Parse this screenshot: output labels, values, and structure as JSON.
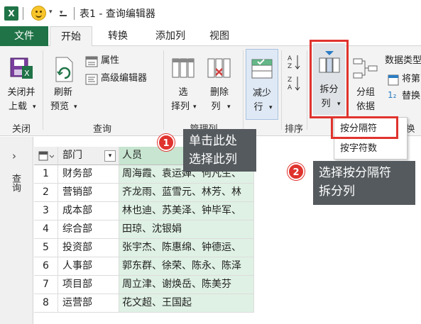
{
  "titlebar": {
    "excel_glyph": "X",
    "title": "表1 - 查询编辑器"
  },
  "tabs": [
    {
      "label": "文件"
    },
    {
      "label": "开始"
    },
    {
      "label": "转换"
    },
    {
      "label": "添加列"
    },
    {
      "label": "视图"
    }
  ],
  "ribbon": {
    "close_load": {
      "line1": "关闭并",
      "line2": "上载",
      "caret": "▾"
    },
    "refresh": {
      "line1": "刷新",
      "line2": "预览",
      "caret": "▾"
    },
    "properties": "属性",
    "advanced_editor": "高级编辑器",
    "choose_columns": {
      "line1": "选",
      "line2": "择列",
      "caret": "▾"
    },
    "remove_columns": {
      "line1": "删除",
      "line2": "列",
      "caret": "▾"
    },
    "reduce_rows": {
      "line1": "减少",
      "line2": "行",
      "caret": "▾"
    },
    "split_column": {
      "line1": "拆分",
      "line2": "列",
      "caret": "▾"
    },
    "group_by": {
      "line1": "分组",
      "line2": "依据"
    },
    "data_type": "数据类型",
    "use_first_row": "将第",
    "replace": "替换",
    "groups": {
      "close": "关闭",
      "query": "查询",
      "manage_columns": "管理列",
      "sort": "排序",
      "transform": "换"
    }
  },
  "dropdown": {
    "items": [
      "按分隔符",
      "按字符数"
    ]
  },
  "sidebar": {
    "label": "查询",
    "chevron": "›"
  },
  "table": {
    "columns": [
      "部门",
      "人员"
    ],
    "rows": [
      {
        "num": "1",
        "dept": "财务部",
        "people": "周海霞、袁运婵、何凡生、"
      },
      {
        "num": "2",
        "dept": "营销部",
        "people": "齐龙雨、蓝雪元、林芳、林"
      },
      {
        "num": "3",
        "dept": "成本部",
        "people": "林也迪、苏美泽、钟毕军、"
      },
      {
        "num": "4",
        "dept": "综合部",
        "people": "田琼、沈银娟"
      },
      {
        "num": "5",
        "dept": "投资部",
        "people": "张宇杰、陈惠绵、钟德运、"
      },
      {
        "num": "6",
        "dept": "人事部",
        "people": "郭东群、徐荣、陈永、陈泽"
      },
      {
        "num": "7",
        "dept": "项目部",
        "people": "周立津、谢焕岳、陈美芬"
      },
      {
        "num": "8",
        "dept": "运营部",
        "people": "花文超、王国起"
      }
    ]
  },
  "callouts": [
    {
      "badge": "1",
      "line1": "单击此处",
      "line2": "选择此列"
    },
    {
      "badge": "2",
      "line1": "选择按分隔符",
      "line2": "拆分列"
    }
  ],
  "colors": {
    "excel_green": "#1f7346",
    "highlight_red": "#e0332e",
    "selected_column": "#dff1e4",
    "callout_bg": "#555a5e"
  }
}
